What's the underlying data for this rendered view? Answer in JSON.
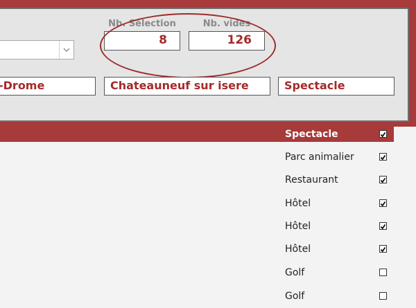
{
  "header": {
    "combo_value": "",
    "selection_label": "Nb. Sélection",
    "selection_value": "8",
    "empty_label": "Nb. vides",
    "empty_value": "126",
    "filter_department": "Drome",
    "filter_department_visible": "-Drome",
    "filter_city": "Chateauneuf sur isere",
    "filter_activity": "Spectacle"
  },
  "list": {
    "rows": [
      {
        "label": "Spectacle",
        "checked": true,
        "selected": true
      },
      {
        "label": "Parc animalier",
        "checked": true,
        "selected": false
      },
      {
        "label": "Restaurant",
        "checked": true,
        "selected": false
      },
      {
        "label": "Hôtel",
        "checked": true,
        "selected": false
      },
      {
        "label": "Hôtel",
        "checked": true,
        "selected": false
      },
      {
        "label": "Hôtel",
        "checked": true,
        "selected": false
      },
      {
        "label": "Golf",
        "checked": false,
        "selected": false
      },
      {
        "label": "Golf",
        "checked": false,
        "selected": false
      }
    ]
  },
  "colors": {
    "accent": "#a73a3a",
    "value_text": "#a52a2a",
    "panel": "#e5e5e5"
  }
}
